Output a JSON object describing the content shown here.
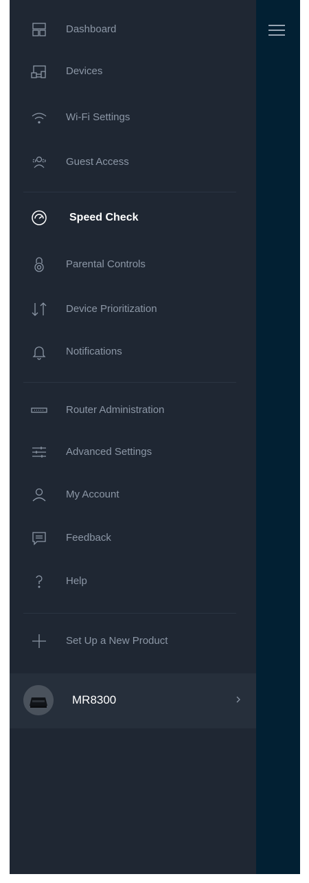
{
  "sidebar": {
    "items": [
      {
        "label": "Dashboard",
        "icon": "dashboard-icon"
      },
      {
        "label": "Devices",
        "icon": "devices-icon"
      },
      {
        "label": "Wi-Fi Settings",
        "icon": "wifi-icon"
      },
      {
        "label": "Guest Access",
        "icon": "guest-access-icon"
      },
      {
        "label": "Speed Check",
        "icon": "speed-check-icon",
        "active": true
      },
      {
        "label": "Parental Controls",
        "icon": "parental-controls-icon"
      },
      {
        "label": "Device Prioritization",
        "icon": "prioritization-icon"
      },
      {
        "label": "Notifications",
        "icon": "bell-icon"
      },
      {
        "label": "Router Administration",
        "icon": "router-icon"
      },
      {
        "label": "Advanced Settings",
        "icon": "sliders-icon"
      },
      {
        "label": "My Account",
        "icon": "user-icon"
      },
      {
        "label": "Feedback",
        "icon": "feedback-icon"
      },
      {
        "label": "Help",
        "icon": "help-icon"
      },
      {
        "label": "Set Up a New Product",
        "icon": "plus-icon"
      }
    ],
    "node": {
      "label": "MR8300",
      "icon": "chevron-right-icon"
    }
  },
  "header": {
    "menu_icon": "hamburger-menu-icon"
  },
  "colors": {
    "drawer": "#1f2733",
    "background": "#022033",
    "label": "#8c97a6",
    "active_label": "#ffffff",
    "icon_stroke": "#8c97a6"
  }
}
